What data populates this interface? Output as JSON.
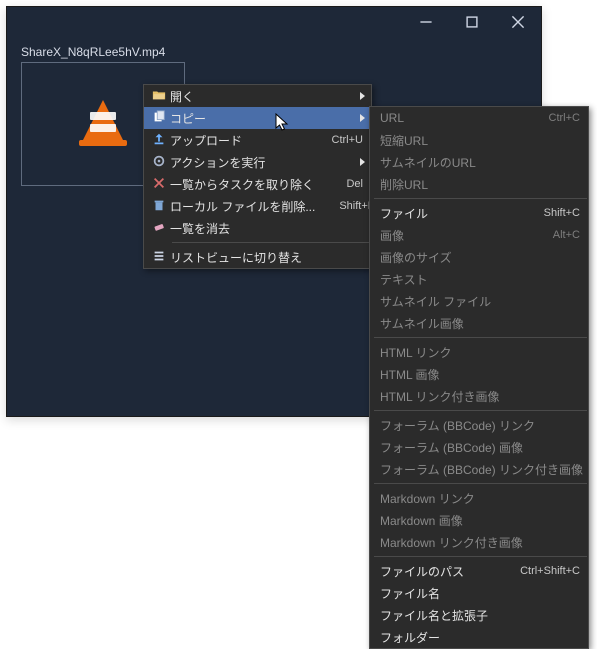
{
  "window": {
    "filename": "ShareX_N8qRLee5hV.mp4"
  },
  "menu": {
    "open": {
      "label": "開く"
    },
    "copy": {
      "label": "コピー"
    },
    "upload": {
      "label": "アップロード",
      "accel": "Ctrl+U"
    },
    "actions": {
      "label": "アクションを実行"
    },
    "removeTask": {
      "label": "一覧からタスクを取り除く",
      "accel": "Del"
    },
    "deleteLocal": {
      "label": "ローカル ファイルを削除...",
      "accel": "Shift+Del"
    },
    "clear": {
      "label": "一覧を消去"
    },
    "listview": {
      "label": "リストビューに切り替え"
    }
  },
  "submenu": {
    "url": {
      "label": "URL",
      "accel": "Ctrl+C"
    },
    "shortUrl": {
      "label": "短縮URL"
    },
    "thumbUrl": {
      "label": "サムネイルのURL"
    },
    "delUrl": {
      "label": "削除URL"
    },
    "file": {
      "label": "ファイル",
      "accel": "Shift+C"
    },
    "image": {
      "label": "画像",
      "accel": "Alt+C"
    },
    "imageSize": {
      "label": "画像のサイズ"
    },
    "text": {
      "label": "テキスト"
    },
    "thumbFile": {
      "label": "サムネイル ファイル"
    },
    "thumbImage": {
      "label": "サムネイル画像"
    },
    "htmlLink": {
      "label": "HTML リンク"
    },
    "htmlImage": {
      "label": "HTML 画像"
    },
    "htmlImgLink": {
      "label": "HTML リンク付き画像"
    },
    "bbLink": {
      "label": "フォーラム (BBCode) リンク"
    },
    "bbImage": {
      "label": "フォーラム (BBCode) 画像"
    },
    "bbImgLink": {
      "label": "フォーラム (BBCode) リンク付き画像"
    },
    "mdLink": {
      "label": "Markdown リンク"
    },
    "mdImage": {
      "label": "Markdown 画像"
    },
    "mdImgLink": {
      "label": "Markdown リンク付き画像"
    },
    "filePath": {
      "label": "ファイルのパス",
      "accel": "Ctrl+Shift+C"
    },
    "fileName": {
      "label": "ファイル名"
    },
    "fileNameExt": {
      "label": "ファイル名と拡張子"
    },
    "folder": {
      "label": "フォルダー"
    }
  }
}
